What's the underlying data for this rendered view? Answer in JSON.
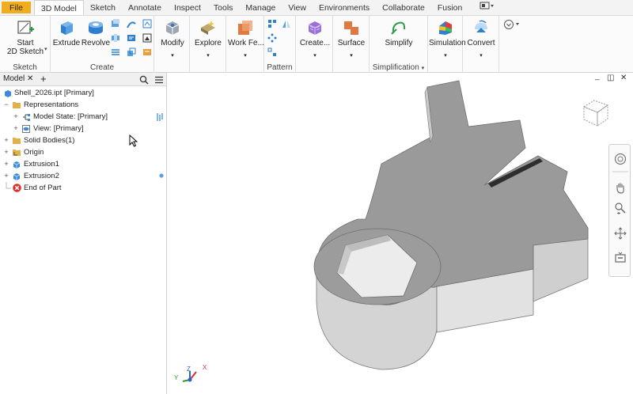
{
  "tabs": [
    "File",
    "3D Model",
    "Sketch",
    "Annotate",
    "Inspect",
    "Tools",
    "Manage",
    "View",
    "Environments",
    "Collaborate",
    "Fusion"
  ],
  "ribbon": {
    "start_sketch": "Start\n2D Sketch",
    "start_sketch_l1": "Start",
    "start_sketch_l2": "2D Sketch",
    "sketch_panel": "Sketch",
    "extrude": "Extrude",
    "revolve": "Revolve",
    "create_panel": "Create",
    "modify": "Modify",
    "explore": "Explore",
    "work_features": "Work Fe...",
    "pattern_panel": "Pattern",
    "create_freeform": "Create...",
    "surface": "Surface",
    "simplify": "Simplify",
    "simplification_panel": "Simplification",
    "simulation": "Simulation",
    "convert": "Convert",
    "dropdown_arrow": "▾"
  },
  "browser": {
    "tab_label": "Model",
    "close_glyph": "✕",
    "add_glyph": "+",
    "items": [
      {
        "label": "Shell_2026.ipt [Primary]",
        "expander": ""
      },
      {
        "label": "Representations",
        "expander": "−"
      },
      {
        "label": "Model State: [Primary]",
        "expander": "+"
      },
      {
        "label": "View: [Primary]",
        "expander": "+"
      },
      {
        "label": "Solid Bodies(1)",
        "expander": "+"
      },
      {
        "label": "Origin",
        "expander": "+"
      },
      {
        "label": "Extrusion1",
        "expander": "+"
      },
      {
        "label": "Extrusion2",
        "expander": "+"
      },
      {
        "label": "End of Part",
        "expander": ""
      }
    ]
  },
  "viewport": {
    "minimize": "_",
    "restore": "◫",
    "close": "✕",
    "axis_x": "X",
    "axis_y": "Y",
    "axis_z": "Z"
  },
  "colors": {
    "file_tab": "#f0ad1d",
    "accent_blue": "#2f7fd1",
    "part_face": "#9a9a9a",
    "part_side": "#d8d8d8",
    "end_of_part_red": "#d9302c"
  }
}
